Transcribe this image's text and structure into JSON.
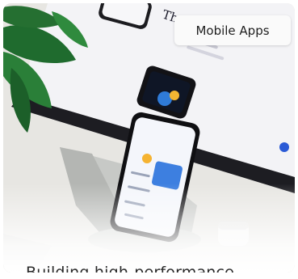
{
  "card": {
    "badge_label": "Mobile Apps",
    "caption": "Building high-performance"
  },
  "photo": {
    "icons": [
      "plant-leaf",
      "monitor",
      "smartphone",
      "earbuds-case",
      "keyboard"
    ]
  }
}
